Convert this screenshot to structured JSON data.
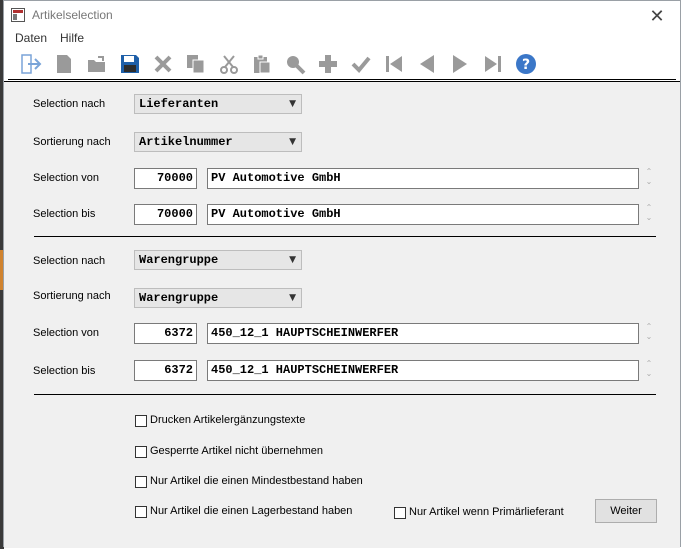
{
  "window": {
    "title": "Artikelselection"
  },
  "menu": {
    "items": [
      "Daten",
      "Hilfe"
    ]
  },
  "toolbar": {
    "buttons": [
      "exit-icon",
      "new-icon",
      "open-icon",
      "save-icon",
      "delete-icon",
      "copy-icon",
      "cut-icon",
      "paste-icon",
      "search-icon",
      "add-icon",
      "confirm-icon",
      "first-record-icon",
      "previous-record-icon",
      "next-record-icon",
      "last-record-icon",
      "help-icon"
    ],
    "colors": {
      "active": "#1e5fa8",
      "disabled": "#9a9a9a",
      "help": "#3b77c8"
    }
  },
  "group1": {
    "selection_nach": {
      "label": "Selection nach",
      "value": "Lieferanten"
    },
    "sortierung_nach": {
      "label": "Sortierung nach",
      "value": "Artikelnummer"
    },
    "selection_von": {
      "label": "Selection von",
      "number": "70000",
      "text": "PV Automotive GmbH"
    },
    "selection_bis": {
      "label": "Selection bis",
      "number": "70000",
      "text": "PV Automotive GmbH"
    }
  },
  "group2": {
    "selection_nach": {
      "label": "Selection nach",
      "value": "Warengruppe"
    },
    "sortierung_nach": {
      "label": "Sortierung nach",
      "value": "Warengruppe"
    },
    "selection_von": {
      "label": "Selection von",
      "number": "6372",
      "text": "450_12_1 HAUPTSCHEINWERFER"
    },
    "selection_bis": {
      "label": "Selection bis",
      "number": "6372",
      "text": "450_12_1 HAUPTSCHEINWERFER"
    }
  },
  "options": {
    "drucken_ergaenzungstexte": {
      "label": "Drucken Artikelergänzungstexte",
      "checked": false
    },
    "gesperrte_nicht_uebernehmen": {
      "label": "Gesperrte Artikel nicht übernehmen",
      "checked": false
    },
    "nur_mindestbestand": {
      "label": "Nur Artikel die einen Mindestbestand haben",
      "checked": false
    },
    "nur_lagerbestand": {
      "label": "Nur Artikel die einen Lagerbestand haben",
      "checked": false
    },
    "nur_primaerlieferant": {
      "label": "Nur Artikel wenn Primärlieferant",
      "checked": false
    }
  },
  "buttons": {
    "weiter": "Weiter"
  }
}
